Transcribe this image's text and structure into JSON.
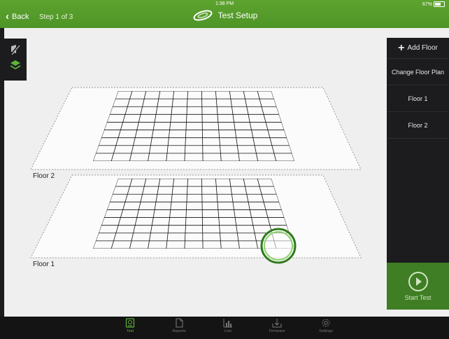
{
  "status": {
    "time": "1:38 PM",
    "battery": "67%",
    "battery_level": 0.67
  },
  "header": {
    "back_label": "Back",
    "step": "Step 1 of 3",
    "title": "Test Setup"
  },
  "sidebar": {
    "add_floor": "Add Floor",
    "items": [
      {
        "label": "Change Floor Plan"
      },
      {
        "label": "Floor 1"
      },
      {
        "label": "Floor 2"
      }
    ]
  },
  "start_test": {
    "label": "Start Test"
  },
  "floors": [
    {
      "label": "Floor 2"
    },
    {
      "label": "Floor 1"
    }
  ],
  "tabs": [
    {
      "label": "Test",
      "icon": "test-icon",
      "active": true
    },
    {
      "label": "Reports",
      "icon": "reports-icon"
    },
    {
      "label": "Live",
      "icon": "live-icon"
    },
    {
      "label": "Firmware",
      "icon": "firmware-icon"
    },
    {
      "label": "Settings",
      "icon": "settings-icon"
    }
  ],
  "colors": {
    "accent": "#5fb339",
    "header": "#55a02b",
    "panel": "#1c1c1e"
  }
}
